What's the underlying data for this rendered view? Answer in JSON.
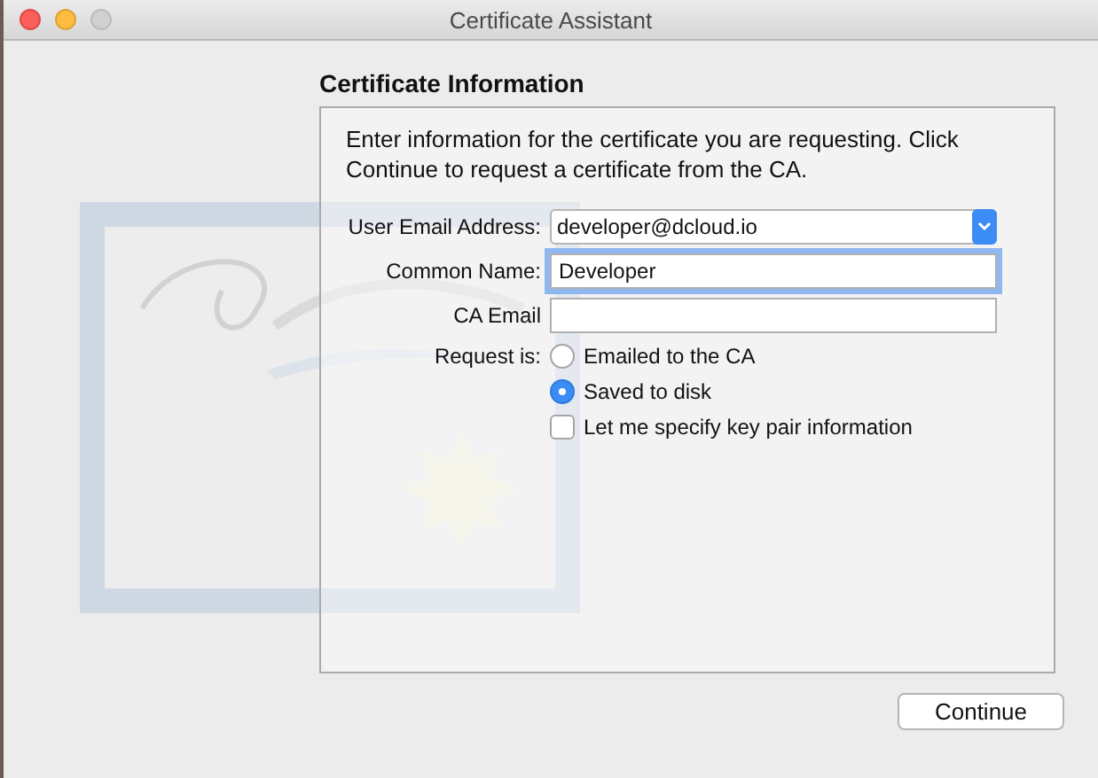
{
  "window": {
    "title": "Certificate Assistant"
  },
  "heading": "Certificate Information",
  "intro": "Enter information for the certificate you are requesting. Click Continue to request a certificate from the CA.",
  "fields": [
    {
      "kind": "dropdown",
      "label": "User Email Address:",
      "value": "developer@dcloud.io",
      "focused": false
    },
    {
      "kind": "text",
      "label": "Common Name:",
      "value": "Developer",
      "focused": true
    },
    {
      "kind": "text",
      "label": "CA Email",
      "focused": false
    }
  ],
  "request": {
    "label": "Request is:",
    "options": [
      {
        "label": "Emailed to the CA",
        "selected": false
      },
      {
        "label": "Saved to disk",
        "selected": true
      }
    ]
  },
  "key_pair": {
    "label": "Let me specify key pair information",
    "checked": false
  },
  "buttons": [
    "Continue"
  ]
}
